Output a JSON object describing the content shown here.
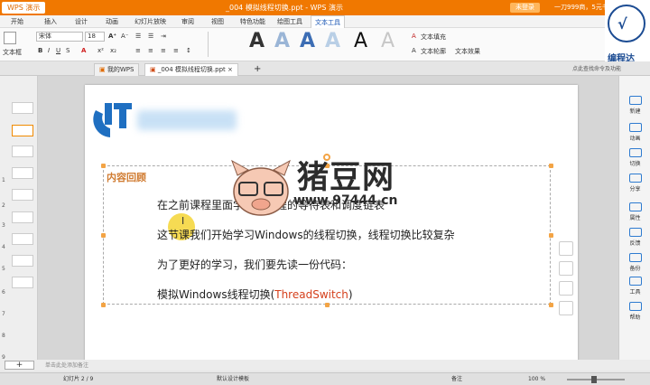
{
  "app": {
    "button": "WPS 演示",
    "title": "_004 模拟线程切换.ppt - WPS 演示",
    "login": "未登录",
    "promo": "一刀999商，5元书券"
  },
  "ribbon_tabs": [
    "开始",
    "插入",
    "设计",
    "动画",
    "幻灯片放映",
    "审阅",
    "视图",
    "特色功能",
    "绘图工具",
    "文本工具"
  ],
  "ribbon_tabs_active": "文本工具",
  "ribbon": {
    "textbox_label": "文本框",
    "font_name": "宋体",
    "font_size": "18",
    "style_letters": [
      "A",
      "A",
      "A",
      "A",
      "A",
      "A"
    ],
    "style_colors": [
      "#222222",
      "#9ab5d6",
      "#3c6db4",
      "#b9cfe6",
      "#111111",
      "#c7c7c7"
    ],
    "text_fill": "文本填充",
    "text_outline": "文本轮廓",
    "text_effect": "文本效果"
  },
  "doc_tabs": [
    {
      "label": "我的WPS"
    },
    {
      "label": "_004 模拟线程切换.ppt"
    }
  ],
  "hint_bar": "点此查找命令及功能",
  "slides_panel": {
    "numbers": [
      "1",
      "2",
      "3",
      "4",
      "5",
      "6",
      "7",
      "8",
      "9"
    ]
  },
  "slide": {
    "section_title": "内容回顾",
    "lines": [
      "在之前课程里面学习了线程的等待表和调度链表",
      "这节课我们开始学习Windows的线程切换，线程切换比较复杂",
      "为了更好的学习，我们要先读一份代码：",
      "模拟Windows线程切换("
    ],
    "code_name": "ThreadSwitch",
    "code_close": ")"
  },
  "watermark": {
    "text": "猪豆网",
    "url": "www.97444.cn"
  },
  "right_panel": [
    "新建",
    "动画",
    "切换",
    "分享",
    "属性",
    "反馈",
    "备份",
    "工具",
    "帮助"
  ],
  "brand": "编程达",
  "add_bar": {
    "add": "+",
    "notes": "单击此处添加备注"
  },
  "status": {
    "slide": "幻灯片 2 / 9",
    "theme": "默认设计模板",
    "notes": "备注",
    "zoom": "100 %"
  },
  "colors": {
    "titlebar": "#f07800",
    "section": "#d07b30",
    "highlight": "#d5401c"
  }
}
